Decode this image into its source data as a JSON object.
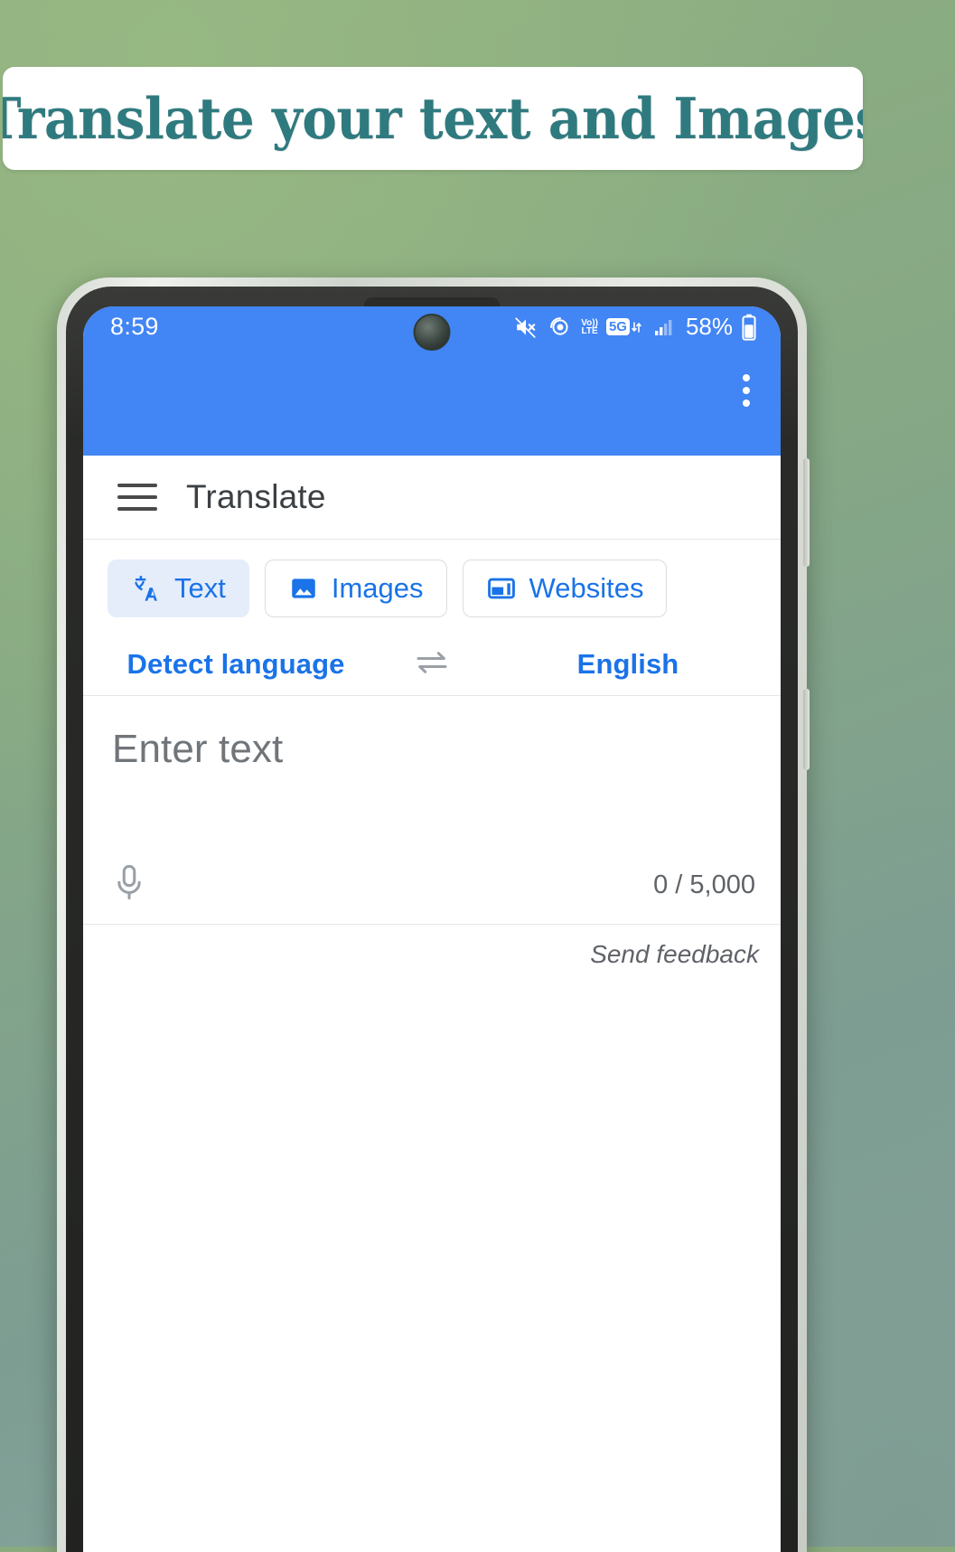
{
  "banner": {
    "text": "Translate your text and Images",
    "text_color": "#2f7a7f",
    "background": "#ffffff"
  },
  "background": {
    "color_top": "#8fb07f",
    "color_bottom": "#8aa9a0"
  },
  "phone": {
    "status_bar": {
      "clock": "8:59",
      "battery_percent": "58%",
      "volte_top": "Vo))",
      "volte_bottom": "LTE",
      "network_badge": "5G",
      "background": "#4285f4",
      "icons": [
        "mute-icon",
        "vibrate-icon",
        "volte-icon",
        "5g-icon",
        "signal-bars-icon",
        "battery-icon"
      ]
    },
    "app_bar": {
      "background": "#4285f4",
      "overflow_menu": "more-options"
    },
    "toolbar": {
      "menu_label": "menu",
      "title": "Translate"
    },
    "tabs": [
      {
        "label": "Text",
        "icon": "translate-icon",
        "active": true
      },
      {
        "label": "Images",
        "icon": "image-icon",
        "active": false
      },
      {
        "label": "Websites",
        "icon": "website-icon",
        "active": false
      }
    ],
    "languages": {
      "source": "Detect language",
      "swap_icon": "swap-horizontal-icon",
      "target": "English"
    },
    "input": {
      "placeholder": "Enter text",
      "value": "",
      "mic_icon": "microphone-icon",
      "char_count": "0 / 5,000"
    },
    "feedback": {
      "label": "Send feedback"
    },
    "accent_color": "#1a73e8"
  }
}
